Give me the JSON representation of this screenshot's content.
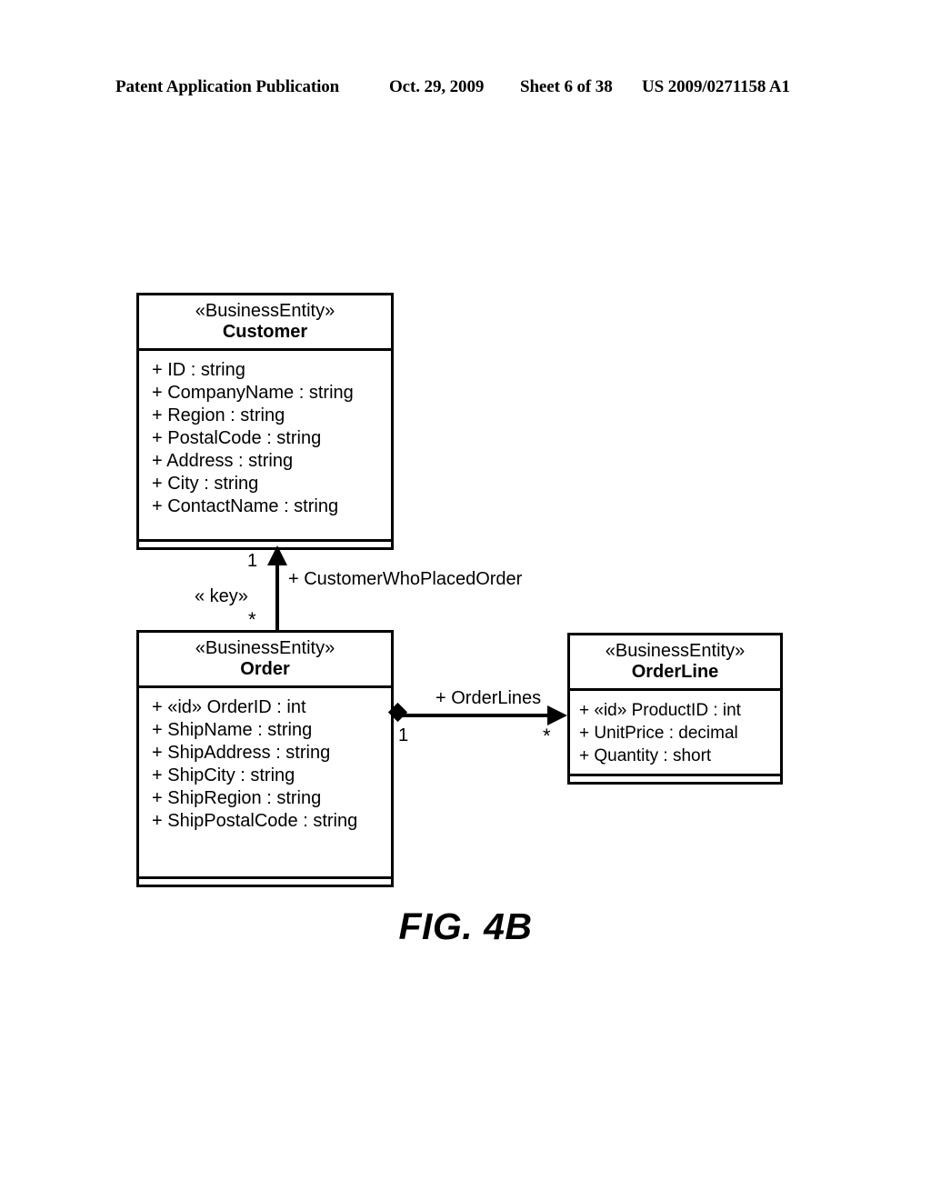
{
  "page": {
    "header": {
      "publication": "Patent Application Publication",
      "date": "Oct. 29, 2009",
      "sheet": "Sheet 6 of 38",
      "number": "US 2009/0271158 A1"
    },
    "figure_caption": "FIG. 4B"
  },
  "diagram": {
    "type": "uml-class-diagram",
    "classes": [
      {
        "id": "customer",
        "stereotype": "«BusinessEntity»",
        "name": "Customer",
        "attributes": [
          "+ ID : string",
          "+ CompanyName : string",
          "+ Region : string",
          "+ PostalCode : string",
          "+ Address : string",
          "+ City : string",
          "+ ContactName : string"
        ],
        "operations": []
      },
      {
        "id": "order",
        "stereotype": "«BusinessEntity»",
        "name": "Order",
        "attributes": [
          "+ «id» OrderID : int",
          "+ ShipName : string",
          "+ ShipAddress : string",
          "+ ShipCity : string",
          "+ ShipRegion : string",
          "+ ShipPostalCode : string"
        ],
        "operations": []
      },
      {
        "id": "orderline",
        "stereotype": "«BusinessEntity»",
        "name": "OrderLine",
        "attributes": [
          "+ «id» ProductID : int",
          "+ UnitPrice : decimal",
          "+ Quantity : short"
        ],
        "operations": []
      }
    ],
    "associations": [
      {
        "id": "order-to-customer",
        "from": "Order",
        "to": "Customer",
        "role": "+  CustomerWhoPlacedOrder",
        "stereotype": "« key»",
        "source_multiplicity": "*",
        "target_multiplicity": "1",
        "arrow": "open-navigable-filled",
        "direction": "up"
      },
      {
        "id": "order-to-orderline",
        "from": "Order",
        "to": "OrderLine",
        "role": "+  OrderLines",
        "source_multiplicity": "1",
        "target_multiplicity": "*",
        "arrow": "filled-arrowhead",
        "source_decoration": "filled-diamond-composition",
        "direction": "right"
      }
    ]
  }
}
